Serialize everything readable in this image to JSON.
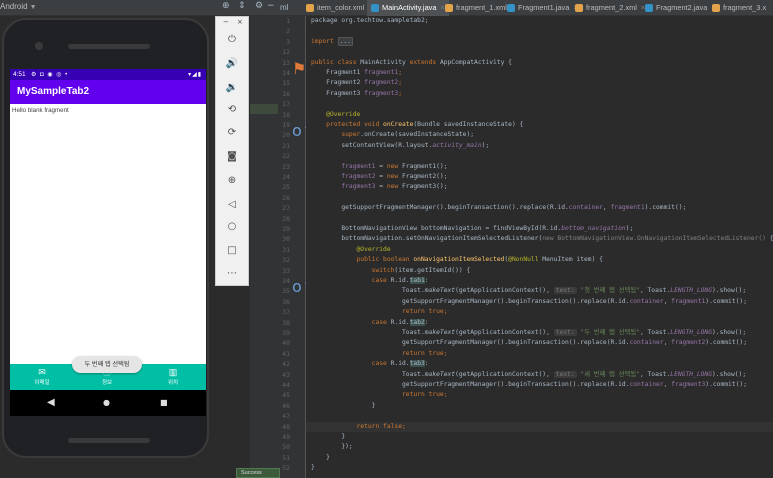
{
  "ide": {
    "project_label": "Android",
    "ml_label": "ml",
    "tabs": [
      {
        "label": "item_color.xml",
        "color": "#e3a34a",
        "active": false
      },
      {
        "label": "MainActivity.java",
        "color": "#3592c4",
        "active": true
      },
      {
        "label": "fragment_1.xml",
        "color": "#e3a34a",
        "active": false
      },
      {
        "label": "Fragment1.java",
        "color": "#3592c4",
        "active": false
      },
      {
        "label": "fragment_2.xml",
        "color": "#e3a34a",
        "active": false
      },
      {
        "label": "Fragment2.java",
        "color": "#3592c4",
        "active": false
      },
      {
        "label": "fragment_3.x",
        "color": "#e3a34a",
        "active": false
      }
    ],
    "tab_close_glyph": "×",
    "toolbar_icons": [
      "gear-icon",
      "sync-icon",
      "minus-icon"
    ],
    "line_numbers": [
      "1",
      "2",
      "3",
      "12",
      "13",
      "14",
      "15",
      "16",
      "17",
      "18",
      "19",
      "20",
      "21",
      "22",
      "23",
      "24",
      "25",
      "26",
      "27",
      "28",
      "29",
      "30",
      "31",
      "32",
      "33",
      "34",
      "35",
      "36",
      "37",
      "38",
      "39",
      "40",
      "41",
      "42",
      "43",
      "44",
      "45",
      "46",
      "47",
      "48",
      "49",
      "50",
      "51",
      "52"
    ],
    "code_lines": {
      "l1": "package org.techtow.sampletab2;",
      "l2": "",
      "l3_kw": "import",
      "l3_fold": "...",
      "l12": "",
      "l13_a": "public class ",
      "l13_b": "MainActivity ",
      "l13_c": "extends ",
      "l13_d": "AppCompatActivity {",
      "l14_a": "    Fragment1 ",
      "l14_b": "fragment1",
      "l14_c": ";",
      "l15_a": "    Fragment2 ",
      "l15_b": "fragment2",
      "l15_c": ";",
      "l16_a": "    Fragment3 ",
      "l16_b": "fragment3",
      "l16_c": ";",
      "l18": "    @Override",
      "l19_a": "    protected void ",
      "l19_b": "onCreate",
      "l19_c": "(Bundle savedInstanceState) {",
      "l20_a": "        super",
      "l20_b": ".onCreate(savedInstanceState);",
      "l21_a": "        setContentView(R.layout.",
      "l21_b": "activity_main",
      "l21_c": ");",
      "l23_a": "        fragment1",
      "l23_b": " = ",
      "l23_c": "new ",
      "l23_d": "Fragment1();",
      "l24_a": "        fragment2",
      "l24_b": " = ",
      "l24_c": "new ",
      "l24_d": "Fragment2();",
      "l25_a": "        fragment3",
      "l25_b": " = ",
      "l25_c": "new ",
      "l25_d": "Fragment3();",
      "l27_a": "        getSupportFragmentManager().beginTransaction().replace(R.id.",
      "l27_b": "container",
      "l27_c": ", ",
      "l27_d": "fragment1",
      "l27_e": ").commit();",
      "l29_a": "        BottomNavigationView bottomNavigation = findViewById(R.id.",
      "l29_b": "bottom_navigation",
      "l29_c": ");",
      "l30_a": "        bottomNavigation.setOnNavigationItemSelectedListener(",
      "l30_b": "new BottomNavigationView.OnNavigationItemSelectedListener()",
      "l30_c": " {",
      "l31": "            @Override",
      "l32_a": "            public boolean ",
      "l32_b": "onNavigationItemSelected",
      "l32_c": "(",
      "l32_d": "@NonNull",
      "l32_e": " MenuItem item) {",
      "l33_a": "                switch",
      "l33_b": "(item.getItemId()) {",
      "case_kw": "case ",
      "case_a": "R.id.",
      "tab1": "tab1",
      "tab2": "tab2",
      "tab3": "tab3",
      "colon": ":",
      "toast_a": "                        Toast.",
      "toast_b": "makeText",
      "toast_c": "(getApplicationContext(), ",
      "text_hint": "text:",
      "toast_s1": "\"첫 번째 탭 선택됨\"",
      "toast_s2": "\"두 번째 탭 선택됨\"",
      "toast_s3": "\"세 번째 탭 선택됨\"",
      "toast_d": ", Toast.",
      "toast_e": "LENGTH_LONG",
      "toast_f": ").show();",
      "replace_a": "                        getSupportFragmentManager().beginTransaction().replace(R.id.",
      "replace_b": "container",
      "replace_c": ", ",
      "replace_f1": "fragment1",
      "replace_f2": "fragment2",
      "replace_f3": "fragment3",
      "replace_d": ").commit();",
      "return_true_a": "                        return ",
      "return_true_b": "true",
      "return_true_c": ";",
      "close_brace_16": "                }",
      "return_false_a": "            return ",
      "return_false_b": "false",
      "return_false_c": ";",
      "close_brace_8": "        }",
      "close_paren": "        });",
      "close_brace_4": "    }",
      "close_brace_0": "}"
    },
    "success_label": "Success"
  },
  "emulator": {
    "status_time": "4:51",
    "status_icons_left": "⚙ ◘ ◉ ◎ •",
    "status_icons_right": "▾◢▮",
    "app_title": "MySampleTab2",
    "fragment_text": "Hello blank fragment",
    "bottom_nav": [
      {
        "label": "이메일",
        "icon": "mail-icon",
        "glyph": "✉"
      },
      {
        "label": "정보",
        "icon": "info-icon",
        "glyph": "ⓘ"
      },
      {
        "label": "위치",
        "icon": "map-icon",
        "glyph": "▥"
      }
    ],
    "toast_text": "두 번째 탭 선택됨",
    "nav_buttons": [
      {
        "icon": "back-icon",
        "glyph": "◀"
      },
      {
        "icon": "home-icon",
        "glyph": "●"
      },
      {
        "icon": "overview-icon",
        "glyph": "■"
      }
    ],
    "window_controls": [
      "−",
      "×"
    ],
    "controls": [
      {
        "name": "power-icon",
        "glyph": "⏻"
      },
      {
        "name": "volume-up-icon",
        "glyph": "🔊"
      },
      {
        "name": "volume-down-icon",
        "glyph": "🔉"
      },
      {
        "name": "rotate-left-icon",
        "glyph": "⟲"
      },
      {
        "name": "rotate-right-icon",
        "glyph": "⟳"
      },
      {
        "name": "camera-icon",
        "glyph": "◙"
      },
      {
        "name": "zoom-icon",
        "glyph": "⊕"
      },
      {
        "name": "back-icon",
        "glyph": "◁"
      },
      {
        "name": "home-icon",
        "glyph": "○"
      },
      {
        "name": "overview-icon",
        "glyph": "□"
      },
      {
        "name": "more-icon",
        "glyph": "⋯"
      }
    ]
  },
  "colors": {
    "app_bar": "#6200ee",
    "status_bar": "#3700b3",
    "bottom_nav": "#00bfa5",
    "editor_bg": "#2b2b2b"
  }
}
